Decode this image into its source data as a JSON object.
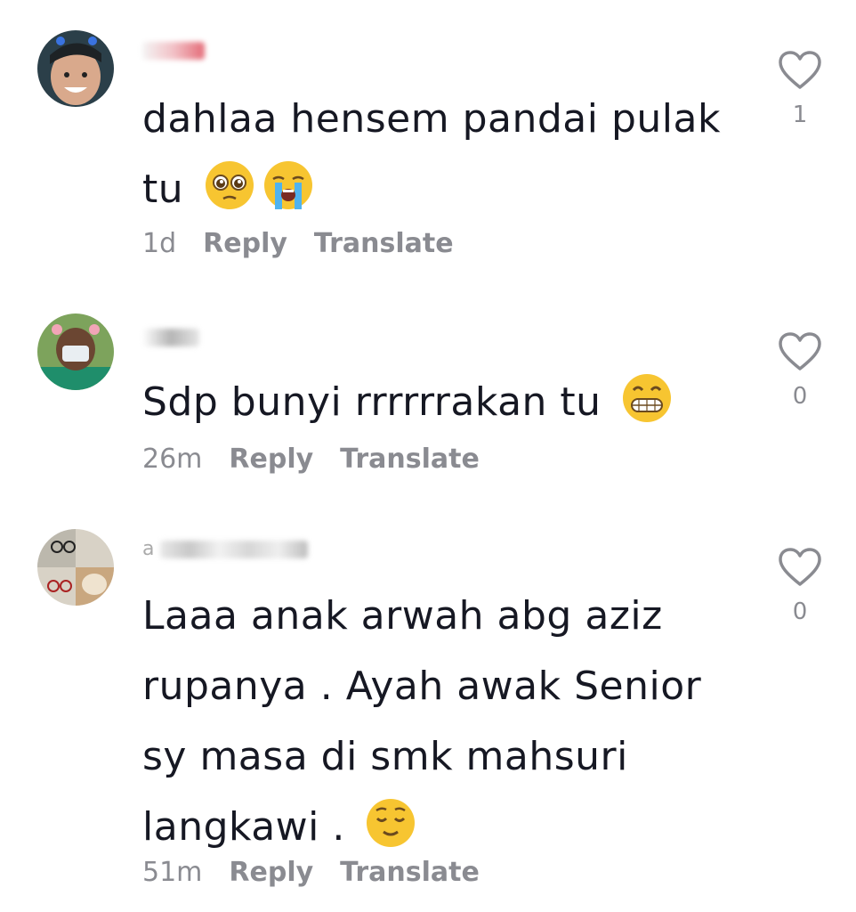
{
  "comments": [
    {
      "username_visible": "",
      "text": "dahlaa hensem pandai pulak tu",
      "emojis": [
        "pleading-face-icon",
        "loudly-crying-face-icon"
      ],
      "time": "1d",
      "reply_label": "Reply",
      "translate_label": "Translate",
      "likes": "1"
    },
    {
      "username_visible": "",
      "text": "Sdp bunyi rrrrrrakan tu",
      "emojis": [
        "grinning-squinting-face-icon"
      ],
      "time": "26m",
      "reply_label": "Reply",
      "translate_label": "Translate",
      "likes": "0"
    },
    {
      "username_visible": "a",
      "text": "Laaa anak arwah abg aziz rupanya . Ayah awak Senior sy masa di smk mahsuri langkawi .",
      "emojis": [
        "relieved-face-icon"
      ],
      "time": "51m",
      "reply_label": "Reply",
      "translate_label": "Translate",
      "likes": "0"
    }
  ],
  "colors": {
    "text": "#161823",
    "meta": "#8a8b91",
    "heart": "#8a8b91"
  }
}
